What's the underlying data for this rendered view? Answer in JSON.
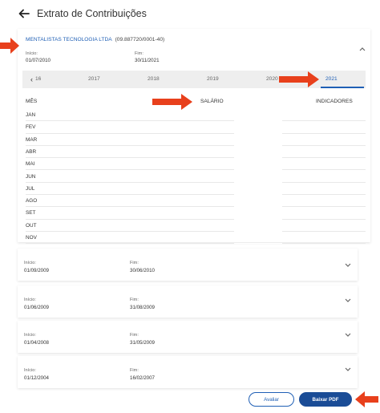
{
  "header": {
    "title": "Extrato de Contribuições"
  },
  "contract": {
    "company": "MENTALISTAS TECNOLOGIA LTDA",
    "cnpj": "(09.887720/0001-40)",
    "start_label": "Início:",
    "start_value": "01/07/2010",
    "end_label": "Fim:",
    "end_value": "30/11/2021"
  },
  "years": [
    "16",
    "2017",
    "2018",
    "2019",
    "2020",
    "2021"
  ],
  "active_year": "2021",
  "table": {
    "col_month": "MÊS",
    "col_salary": "SALÁRIO",
    "col_indicators": "INDICADORES",
    "months": [
      "JAN",
      "FEV",
      "MAR",
      "ABR",
      "MAI",
      "JUN",
      "JUL",
      "AGO",
      "SET",
      "OUT",
      "NOV"
    ]
  },
  "periods": [
    {
      "start_label": "Início:",
      "start_value": "01/09/2009",
      "end_label": "Fim:",
      "end_value": "30/06/2010"
    },
    {
      "start_label": "Início:",
      "start_value": "01/06/2009",
      "end_label": "Fim:",
      "end_value": "31/08/2009"
    },
    {
      "start_label": "Início:",
      "start_value": "01/04/2008",
      "end_label": "Fim:",
      "end_value": "31/05/2009"
    },
    {
      "start_label": "Início:",
      "start_value": "01/12/2004",
      "end_label": "Fim:",
      "end_value": "16/02/2007"
    }
  ],
  "buttons": {
    "evaluate": "Avaliar",
    "download": "Baixar PDF"
  },
  "colors": {
    "accent": "#1f5fb5",
    "button": "#1a4c96",
    "annotation_arrow": "#e8401c"
  },
  "icons": {
    "back": "arrow-left-icon",
    "collapse": "chevron-up-icon",
    "expand": "chevron-down-icon",
    "prev": "chevron-left-icon"
  }
}
